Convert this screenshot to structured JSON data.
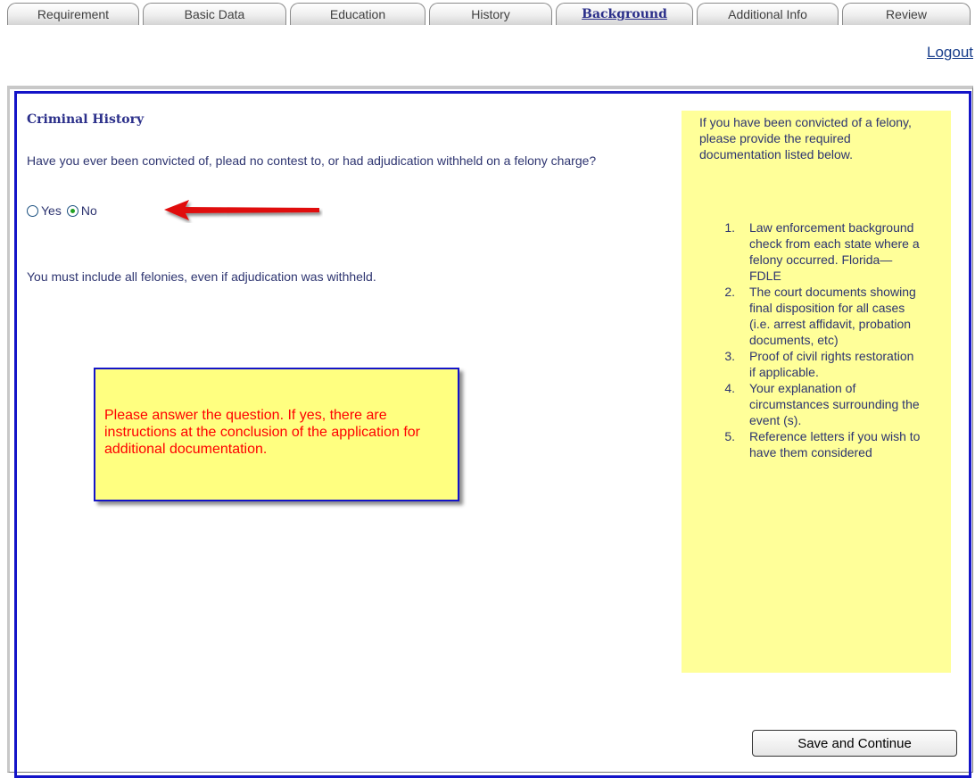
{
  "tabs": [
    {
      "label": "Requirement",
      "active": false
    },
    {
      "label": "Basic Data",
      "active": false
    },
    {
      "label": "Education",
      "active": false
    },
    {
      "label": "History",
      "active": false
    },
    {
      "label": "Background",
      "active": true
    },
    {
      "label": "Additional Info",
      "active": false
    },
    {
      "label": "Review",
      "active": false
    }
  ],
  "header": {
    "logout_label": "Logout"
  },
  "section": {
    "title": "Criminal History",
    "question": "Have you ever been convicted of, plead no contest to, or had adjudication withheld on a felony charge?",
    "options": [
      {
        "label": "Yes",
        "checked": false
      },
      {
        "label": "No",
        "checked": true
      }
    ],
    "note": "You must include all felonies, even if adjudication was withheld."
  },
  "callout": {
    "text": "Please answer the question.  If yes, there are instructions at the conclusion of the application for additional documentation."
  },
  "sidebar": {
    "intro": "If you have been convicted of a felony, please provide the required documentation listed below.",
    "items": [
      {
        "num": "1.",
        "text": "Law enforcement background check from each state where a felony occurred. Florida—FDLE"
      },
      {
        "num": "2.",
        "text": "The court documents showing final disposition for all cases (i.e. arrest affidavit, probation documents, etc)"
      },
      {
        "num": "3.",
        "text": "Proof of civil rights restoration if applicable."
      },
      {
        "num": "4.",
        "text": "Your explanation of circumstances surrounding the event (s)."
      },
      {
        "num": "5.",
        "text": "Reference letters if you wish to have them considered"
      }
    ]
  },
  "actions": {
    "save_label": "Save and Continue"
  },
  "colors": {
    "panel_border": "#1414c8",
    "sidebar_bg": "#ffff99",
    "callout_bg": "#ffff80",
    "callout_text": "#ff0000",
    "arrow": "#e01010",
    "radio_selected": "#21a121"
  },
  "icons": {
    "annotation_arrow": "red-arrow-icon"
  }
}
